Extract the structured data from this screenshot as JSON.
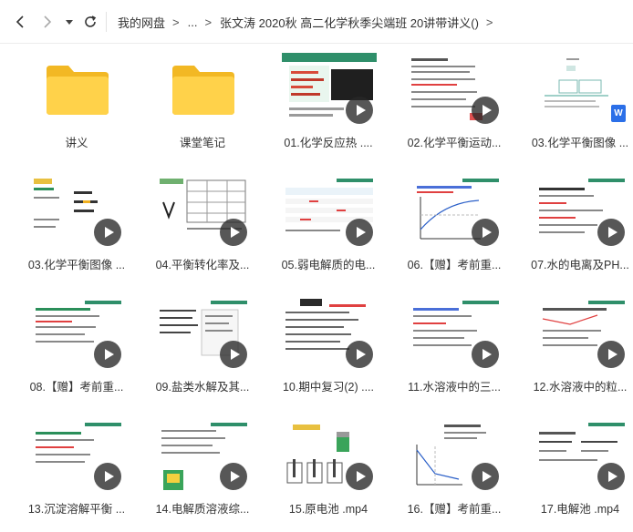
{
  "breadcrumb": {
    "root": "我的网盘",
    "ellipsis": "...",
    "current": "张文涛 2020秋 高二化学秋季尖端班 20讲带讲义()"
  },
  "nav_icons": [
    "back-arrow-icon",
    "forward-arrow-icon",
    "history-dropdown-icon",
    "refresh-icon"
  ],
  "items": [
    {
      "label": "讲义",
      "kind": "folder"
    },
    {
      "label": "课堂笔记",
      "kind": "folder"
    },
    {
      "label": "01.化学反应热 ....",
      "kind": "video"
    },
    {
      "label": "02.化学平衡运动...",
      "kind": "video"
    },
    {
      "label": "03.化学平衡图像 ...",
      "kind": "doc"
    },
    {
      "label": "03.化学平衡图像 ...",
      "kind": "video"
    },
    {
      "label": "04.平衡转化率及...",
      "kind": "video"
    },
    {
      "label": "05.弱电解质的电...",
      "kind": "video"
    },
    {
      "label": "06.【赠】考前重...",
      "kind": "video"
    },
    {
      "label": "07.水的电离及PH...",
      "kind": "video"
    },
    {
      "label": "08.【赠】考前重...",
      "kind": "video"
    },
    {
      "label": "09.盐类水解及其...",
      "kind": "video"
    },
    {
      "label": "10.期中复习(2) ....",
      "kind": "video"
    },
    {
      "label": "11.水溶液中的三...",
      "kind": "video"
    },
    {
      "label": "12.水溶液中的粒...",
      "kind": "video"
    },
    {
      "label": "13.沉淀溶解平衡 ...",
      "kind": "video"
    },
    {
      "label": "14.电解质溶液综...",
      "kind": "video"
    },
    {
      "label": "15.原电池 .mp4",
      "kind": "video"
    },
    {
      "label": "16.【赠】考前重...",
      "kind": "video"
    },
    {
      "label": "17.电解池 .mp4",
      "kind": "video"
    }
  ],
  "colors": {
    "folder": "#f7c533",
    "folder_front": "#ffd64f",
    "slide_green": "#7fbf7f",
    "play_bg": "#2b2b2b",
    "doc_badge": "#2b6fe8"
  },
  "doc_badge_letter": "W"
}
